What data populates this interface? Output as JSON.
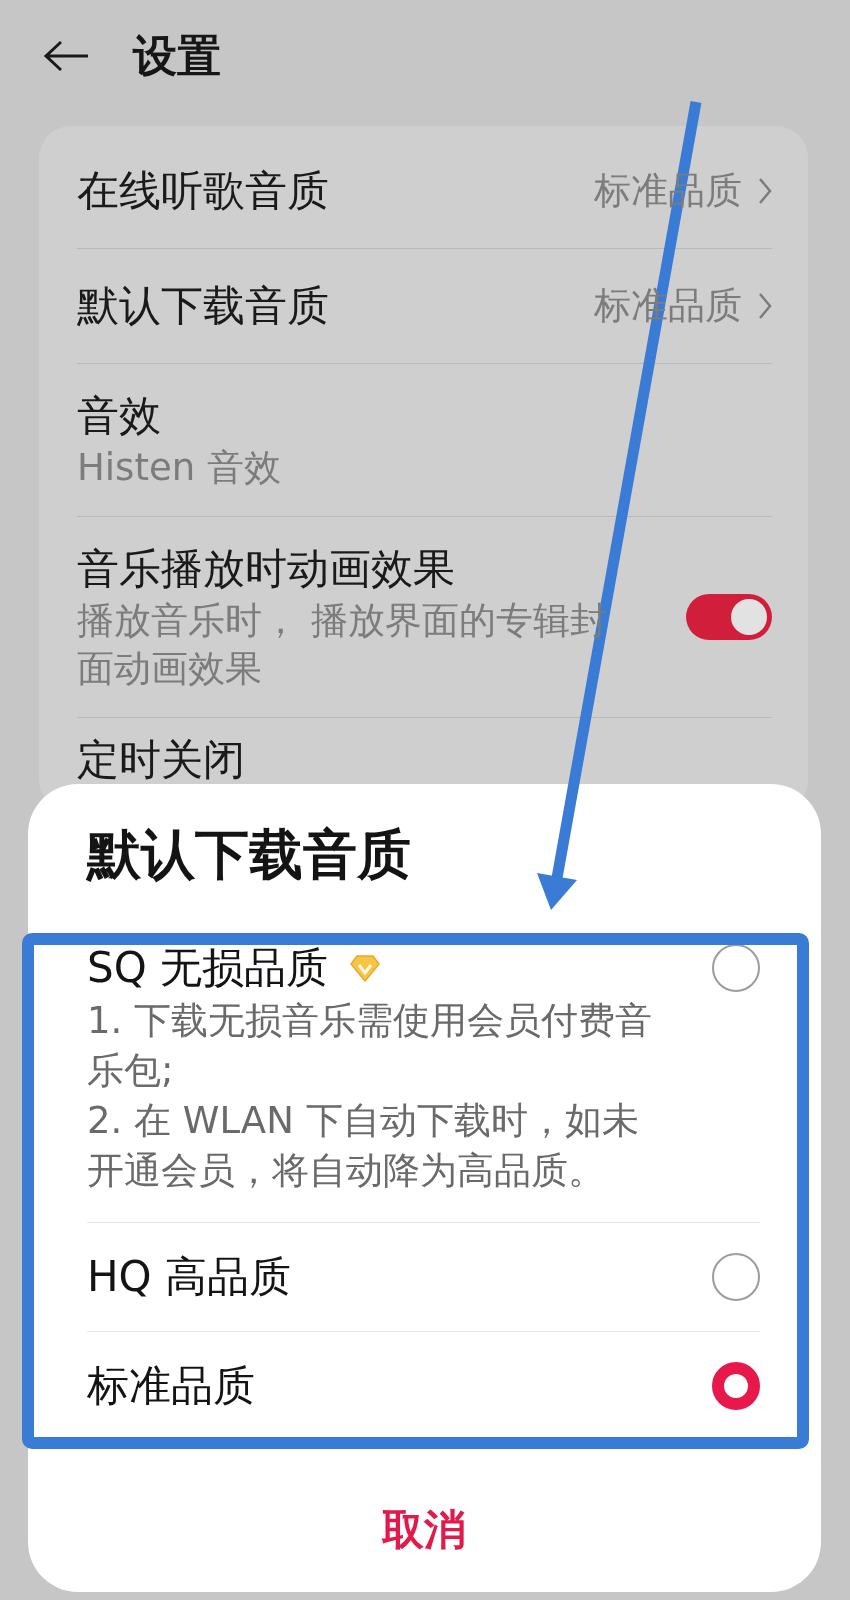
{
  "header": {
    "title": "设置"
  },
  "settings": [
    {
      "kind": "value",
      "title": "在线听歌音质",
      "value": "标准品质"
    },
    {
      "kind": "value",
      "title": "默认下载音质",
      "value": "标准品质"
    },
    {
      "kind": "subtitle",
      "title": "音效",
      "subtitle": "Histen 音效"
    },
    {
      "kind": "toggle",
      "title": "音乐播放时动画效果",
      "subtitle": "播放音乐时， 播放界面的专辑封面动画效果",
      "on": true
    },
    {
      "kind": "plain",
      "title": "定时关闭"
    }
  ],
  "dialog": {
    "title": "默认下载音质",
    "options": [
      {
        "label": "SQ 无损品质",
        "premium": true,
        "description": [
          "1. 下载无损音乐需使用会员付费音乐包;",
          "2. 在 WLAN 下自动下载时，如未开通会员，将自动降为高品质。"
        ],
        "selected": false
      },
      {
        "label": "HQ 高品质",
        "premium": false,
        "selected": false
      },
      {
        "label": "标准品质",
        "premium": false,
        "selected": true
      }
    ],
    "cancel": "取消"
  }
}
